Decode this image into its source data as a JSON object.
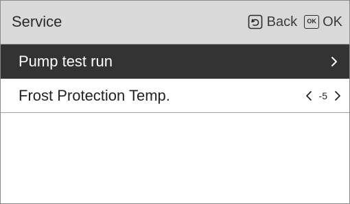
{
  "header": {
    "title": "Service",
    "back_label": "Back",
    "ok_label": "OK",
    "ok_icon_text": "OK",
    "back_icon": "back-return-icon",
    "ok_icon": "ok-key-icon"
  },
  "menu": {
    "items": [
      {
        "label": "Pump test run",
        "selected": true,
        "control": "chevron-right-icon"
      },
      {
        "label": "Frost Protection Temp.",
        "selected": false,
        "value": "-5",
        "control": "left-right-arrows"
      }
    ]
  },
  "colors": {
    "header_bg": "#d9d9d9",
    "selected_bg": "#333333",
    "selected_text": "#ffffff",
    "text": "#222222"
  }
}
